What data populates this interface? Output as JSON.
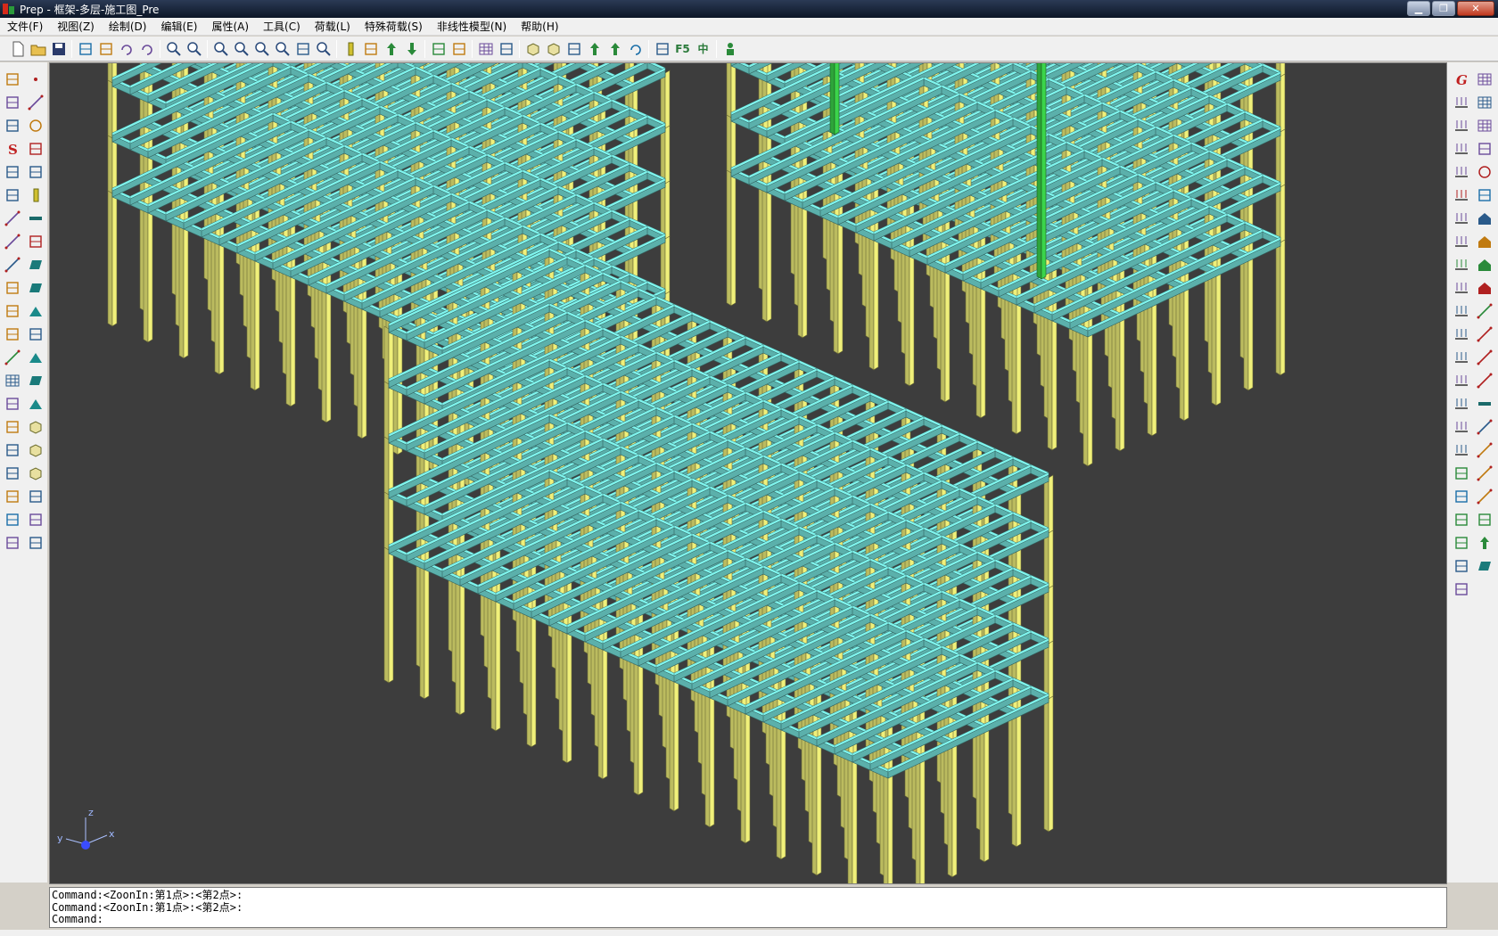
{
  "window": {
    "title": "Prep - 框架-多层-施工图_Pre",
    "buttons": {
      "minimize": "▁",
      "maximize": "❐",
      "close": "✕"
    }
  },
  "menu": [
    {
      "label": "文件(F)",
      "name": "menu-file"
    },
    {
      "label": "视图(Z)",
      "name": "menu-view"
    },
    {
      "label": "绘制(D)",
      "name": "menu-draw"
    },
    {
      "label": "编辑(E)",
      "name": "menu-edit"
    },
    {
      "label": "属性(A)",
      "name": "menu-attributes"
    },
    {
      "label": "工具(C)",
      "name": "menu-tools"
    },
    {
      "label": "荷载(L)",
      "name": "menu-load"
    },
    {
      "label": "特殊荷载(S)",
      "name": "menu-special-load"
    },
    {
      "label": "非线性模型(N)",
      "name": "menu-nonlinear-model"
    },
    {
      "label": "帮助(H)",
      "name": "menu-help"
    }
  ],
  "toolbar": {
    "groups": [
      [
        "new-file-icon",
        "open-folder-icon",
        "save-icon"
      ],
      [
        "select-window-icon",
        "pencil-icon",
        "undo-icon",
        "redo-icon"
      ],
      [
        "zoom-all-icon",
        "zoom-extents-icon"
      ],
      [
        "zoom-in-icon",
        "zoom-out-icon",
        "zoom-window-icon",
        "zoom-previous-icon",
        "rotate-view-icon",
        "zoom-dynamic-icon"
      ],
      [
        "column-icon",
        "floor-layers-icon",
        "floor-up-icon",
        "floor-down-icon"
      ],
      [
        "elevation-view-icon",
        "section-view-icon"
      ],
      [
        "story-list-icon",
        "story-stack-icon"
      ],
      [
        "box-view-icon",
        "box-wire-icon",
        "cut-section-icon",
        "support-icon",
        "support-alt-icon",
        "refresh-icon"
      ],
      [
        "render-mode-icon",
        "f5-refresh-icon",
        "grid-icon"
      ],
      [
        "person-icon"
      ]
    ],
    "f5_label": "F5",
    "grid_glyph": "中"
  },
  "left_toolbar": {
    "col1": [
      "eraser-icon",
      "copy-icon",
      "paste-icon",
      "s-icon",
      "arc-c-icon",
      "angle-icon",
      "line-split-icon",
      "line-cross-icon",
      "dashed-line-icon",
      "corner-icon",
      "fillet-icon",
      "extend-icon",
      "dim-line-icon",
      "table-icon",
      "move-icon",
      "rotate-icon",
      "array-icon",
      "scale-icon",
      "mirror-icon",
      "explode-icon",
      "properties-icon"
    ],
    "col2": [
      "point-icon",
      "line-icon",
      "circle-icon",
      "arc-icon",
      "curve-icon",
      "column-draw-icon",
      "beam-draw-icon",
      "arc-shape-icon",
      "wall-icon",
      "slab-icon",
      "ramp-icon",
      "brace-icon",
      "triangle-icon",
      "parallelogram-icon",
      "roof-icon",
      "block-icon",
      "cube-icon",
      "cube-alt-icon",
      "shape-icon",
      "hook-icon",
      "stair-icon"
    ]
  },
  "right_toolbar": {
    "col1": [
      "g-icon",
      "point-load-icon",
      "distributed-load-icon",
      "floor-load-icon",
      "stack-load-icon",
      "beam-load-icon",
      "arrow-load-icon",
      "slope-load-icon",
      "pin-load-icon",
      "frame-load-icon",
      "frame-load2-icon",
      "frame-load3-icon",
      "frame-load4-icon",
      "stair-load-icon",
      "stair-load2-icon",
      "hatch-load-icon",
      "hatch-load2-icon",
      "elevator-icon",
      "antenna-icon",
      "antenna2-icon",
      "antenna3-icon",
      "rect-select-icon",
      "rect-cross-icon"
    ],
    "col2": [
      "grid-table-icon",
      "grid-table2-icon",
      "list-icon",
      "edit-icon",
      "no-circle-icon",
      "cluster-icon",
      "house-icon",
      "house2-icon",
      "building-icon",
      "building2-icon",
      "diagonal-icon",
      "diagonal2-icon",
      "diagonal3-icon",
      "diagonal4-icon",
      "beam-span-icon",
      "rebar-icon",
      "rebar2-icon",
      "rebar3-icon",
      "rebar4-icon",
      "hook-bar-icon",
      "stirrup-icon",
      "slab-bar-icon"
    ]
  },
  "viewport": {
    "background": "#3d3d3d",
    "beam_color": "#7ff5ee",
    "column_color": "#f0f07a",
    "highlight_color": "#3bd44a",
    "axis": {
      "x": "x",
      "y": "y",
      "z": "z"
    }
  },
  "command_window": {
    "lines": [
      "Command:<ZoonIn:第1点>:<第2点>:",
      "Command:<ZoonIn:第1点>:<第2点>:",
      "Command:"
    ]
  }
}
